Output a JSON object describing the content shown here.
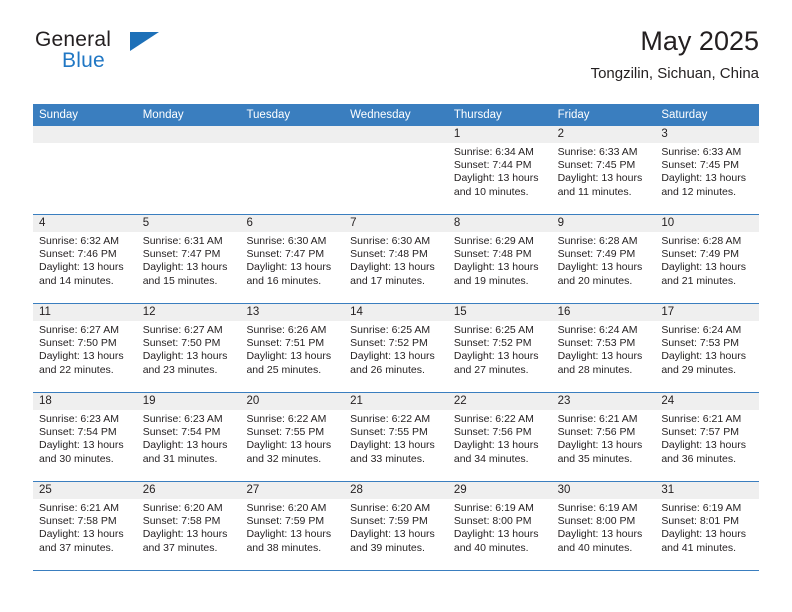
{
  "brand": {
    "line1": "General",
    "line2": "Blue",
    "flag_color": "#1d70b8",
    "blue_text_color": "#2077c4"
  },
  "header": {
    "month_title": "May 2025",
    "location": "Tongzilin, Sichuan, China"
  },
  "calendar": {
    "header_bg": "#3a7ebf",
    "daynum_bg": "#efefef",
    "weekdays": [
      "Sunday",
      "Monday",
      "Tuesday",
      "Wednesday",
      "Thursday",
      "Friday",
      "Saturday"
    ],
    "labels": {
      "sunrise": "Sunrise:",
      "sunset": "Sunset:",
      "daylight": "Daylight:"
    },
    "weeks": [
      [
        {
          "empty": true
        },
        {
          "empty": true
        },
        {
          "empty": true
        },
        {
          "empty": true
        },
        {
          "day": "1",
          "sunrise": "Sunrise: 6:34 AM",
          "sunset": "Sunset: 7:44 PM",
          "daylight_1": "Daylight: 13 hours",
          "daylight_2": "and 10 minutes."
        },
        {
          "day": "2",
          "sunrise": "Sunrise: 6:33 AM",
          "sunset": "Sunset: 7:45 PM",
          "daylight_1": "Daylight: 13 hours",
          "daylight_2": "and 11 minutes."
        },
        {
          "day": "3",
          "sunrise": "Sunrise: 6:33 AM",
          "sunset": "Sunset: 7:45 PM",
          "daylight_1": "Daylight: 13 hours",
          "daylight_2": "and 12 minutes."
        }
      ],
      [
        {
          "day": "4",
          "sunrise": "Sunrise: 6:32 AM",
          "sunset": "Sunset: 7:46 PM",
          "daylight_1": "Daylight: 13 hours",
          "daylight_2": "and 14 minutes."
        },
        {
          "day": "5",
          "sunrise": "Sunrise: 6:31 AM",
          "sunset": "Sunset: 7:47 PM",
          "daylight_1": "Daylight: 13 hours",
          "daylight_2": "and 15 minutes."
        },
        {
          "day": "6",
          "sunrise": "Sunrise: 6:30 AM",
          "sunset": "Sunset: 7:47 PM",
          "daylight_1": "Daylight: 13 hours",
          "daylight_2": "and 16 minutes."
        },
        {
          "day": "7",
          "sunrise": "Sunrise: 6:30 AM",
          "sunset": "Sunset: 7:48 PM",
          "daylight_1": "Daylight: 13 hours",
          "daylight_2": "and 17 minutes."
        },
        {
          "day": "8",
          "sunrise": "Sunrise: 6:29 AM",
          "sunset": "Sunset: 7:48 PM",
          "daylight_1": "Daylight: 13 hours",
          "daylight_2": "and 19 minutes."
        },
        {
          "day": "9",
          "sunrise": "Sunrise: 6:28 AM",
          "sunset": "Sunset: 7:49 PM",
          "daylight_1": "Daylight: 13 hours",
          "daylight_2": "and 20 minutes."
        },
        {
          "day": "10",
          "sunrise": "Sunrise: 6:28 AM",
          "sunset": "Sunset: 7:49 PM",
          "daylight_1": "Daylight: 13 hours",
          "daylight_2": "and 21 minutes."
        }
      ],
      [
        {
          "day": "11",
          "sunrise": "Sunrise: 6:27 AM",
          "sunset": "Sunset: 7:50 PM",
          "daylight_1": "Daylight: 13 hours",
          "daylight_2": "and 22 minutes."
        },
        {
          "day": "12",
          "sunrise": "Sunrise: 6:27 AM",
          "sunset": "Sunset: 7:50 PM",
          "daylight_1": "Daylight: 13 hours",
          "daylight_2": "and 23 minutes."
        },
        {
          "day": "13",
          "sunrise": "Sunrise: 6:26 AM",
          "sunset": "Sunset: 7:51 PM",
          "daylight_1": "Daylight: 13 hours",
          "daylight_2": "and 25 minutes."
        },
        {
          "day": "14",
          "sunrise": "Sunrise: 6:25 AM",
          "sunset": "Sunset: 7:52 PM",
          "daylight_1": "Daylight: 13 hours",
          "daylight_2": "and 26 minutes."
        },
        {
          "day": "15",
          "sunrise": "Sunrise: 6:25 AM",
          "sunset": "Sunset: 7:52 PM",
          "daylight_1": "Daylight: 13 hours",
          "daylight_2": "and 27 minutes."
        },
        {
          "day": "16",
          "sunrise": "Sunrise: 6:24 AM",
          "sunset": "Sunset: 7:53 PM",
          "daylight_1": "Daylight: 13 hours",
          "daylight_2": "and 28 minutes."
        },
        {
          "day": "17",
          "sunrise": "Sunrise: 6:24 AM",
          "sunset": "Sunset: 7:53 PM",
          "daylight_1": "Daylight: 13 hours",
          "daylight_2": "and 29 minutes."
        }
      ],
      [
        {
          "day": "18",
          "sunrise": "Sunrise: 6:23 AM",
          "sunset": "Sunset: 7:54 PM",
          "daylight_1": "Daylight: 13 hours",
          "daylight_2": "and 30 minutes."
        },
        {
          "day": "19",
          "sunrise": "Sunrise: 6:23 AM",
          "sunset": "Sunset: 7:54 PM",
          "daylight_1": "Daylight: 13 hours",
          "daylight_2": "and 31 minutes."
        },
        {
          "day": "20",
          "sunrise": "Sunrise: 6:22 AM",
          "sunset": "Sunset: 7:55 PM",
          "daylight_1": "Daylight: 13 hours",
          "daylight_2": "and 32 minutes."
        },
        {
          "day": "21",
          "sunrise": "Sunrise: 6:22 AM",
          "sunset": "Sunset: 7:55 PM",
          "daylight_1": "Daylight: 13 hours",
          "daylight_2": "and 33 minutes."
        },
        {
          "day": "22",
          "sunrise": "Sunrise: 6:22 AM",
          "sunset": "Sunset: 7:56 PM",
          "daylight_1": "Daylight: 13 hours",
          "daylight_2": "and 34 minutes."
        },
        {
          "day": "23",
          "sunrise": "Sunrise: 6:21 AM",
          "sunset": "Sunset: 7:56 PM",
          "daylight_1": "Daylight: 13 hours",
          "daylight_2": "and 35 minutes."
        },
        {
          "day": "24",
          "sunrise": "Sunrise: 6:21 AM",
          "sunset": "Sunset: 7:57 PM",
          "daylight_1": "Daylight: 13 hours",
          "daylight_2": "and 36 minutes."
        }
      ],
      [
        {
          "day": "25",
          "sunrise": "Sunrise: 6:21 AM",
          "sunset": "Sunset: 7:58 PM",
          "daylight_1": "Daylight: 13 hours",
          "daylight_2": "and 37 minutes."
        },
        {
          "day": "26",
          "sunrise": "Sunrise: 6:20 AM",
          "sunset": "Sunset: 7:58 PM",
          "daylight_1": "Daylight: 13 hours",
          "daylight_2": "and 37 minutes."
        },
        {
          "day": "27",
          "sunrise": "Sunrise: 6:20 AM",
          "sunset": "Sunset: 7:59 PM",
          "daylight_1": "Daylight: 13 hours",
          "daylight_2": "and 38 minutes."
        },
        {
          "day": "28",
          "sunrise": "Sunrise: 6:20 AM",
          "sunset": "Sunset: 7:59 PM",
          "daylight_1": "Daylight: 13 hours",
          "daylight_2": "and 39 minutes."
        },
        {
          "day": "29",
          "sunrise": "Sunrise: 6:19 AM",
          "sunset": "Sunset: 8:00 PM",
          "daylight_1": "Daylight: 13 hours",
          "daylight_2": "and 40 minutes."
        },
        {
          "day": "30",
          "sunrise": "Sunrise: 6:19 AM",
          "sunset": "Sunset: 8:00 PM",
          "daylight_1": "Daylight: 13 hours",
          "daylight_2": "and 40 minutes."
        },
        {
          "day": "31",
          "sunrise": "Sunrise: 6:19 AM",
          "sunset": "Sunset: 8:01 PM",
          "daylight_1": "Daylight: 13 hours",
          "daylight_2": "and 41 minutes."
        }
      ]
    ]
  }
}
